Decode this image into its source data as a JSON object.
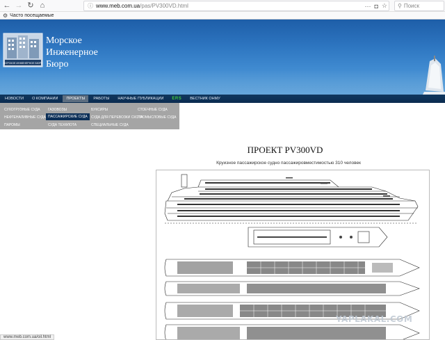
{
  "browser": {
    "url_host": "www.meb.com.ua",
    "url_path": "/pas/PV300VD.html",
    "search_placeholder": "Поиск",
    "bookmark_label": "Часто посещаемые",
    "status_url": "www.meb.com.ua/oil.html"
  },
  "site": {
    "title_line1": "Морское",
    "title_line2": "Инженерное",
    "title_line3": "Бюро",
    "logo_text": "МОРСКОЕ ИНЖЕНЕРНОЕ БЮРО"
  },
  "mainmenu": [
    {
      "label": "НОВОСТИ"
    },
    {
      "label": "О КОМПАНИИ"
    },
    {
      "label": "ПРОЕКТЫ"
    },
    {
      "label": "РАБОТЫ"
    },
    {
      "label": "НАУЧНЫЕ ПУБЛИКАЦИИ"
    },
    {
      "label": "ERS"
    },
    {
      "label": "ВЕСТНИК ОНМУ"
    }
  ],
  "submenu": {
    "col1": [
      "СУХОГРУЗНЫЕ СУДА",
      "НЕФТЕНАЛИВНЫЕ СУДА",
      "ПАРОМЫ"
    ],
    "col2": [
      "ГАЗОВОЗЫ",
      "ПАССАЖИРСКИЕ СУДА",
      "СУДА ТЕХФЛОТА"
    ],
    "col3": [
      "БУКСИРЫ",
      "СУДА ДЛЯ ПЕРЕВОЗКИ СКОТА",
      "СПЕЦИАЛЬНЫЕ СУДА"
    ],
    "col4": [
      "СТОЕЧНЫЕ СУДА",
      "ПРОМЫСЛОВЫЕ СУДА"
    ]
  },
  "content": {
    "title": "ПРОЕКТ PV300VD",
    "subtitle": "Круизное пассажирское судно пассажировместимостью 310 человек"
  },
  "watermark": "YAPLAKAL.COM",
  "colors": {
    "header_blue": "#2d75c0",
    "menu_navy": "#0b2c50",
    "submenu_gray": "#a5a5a5",
    "ers_green": "#3fc93f"
  }
}
